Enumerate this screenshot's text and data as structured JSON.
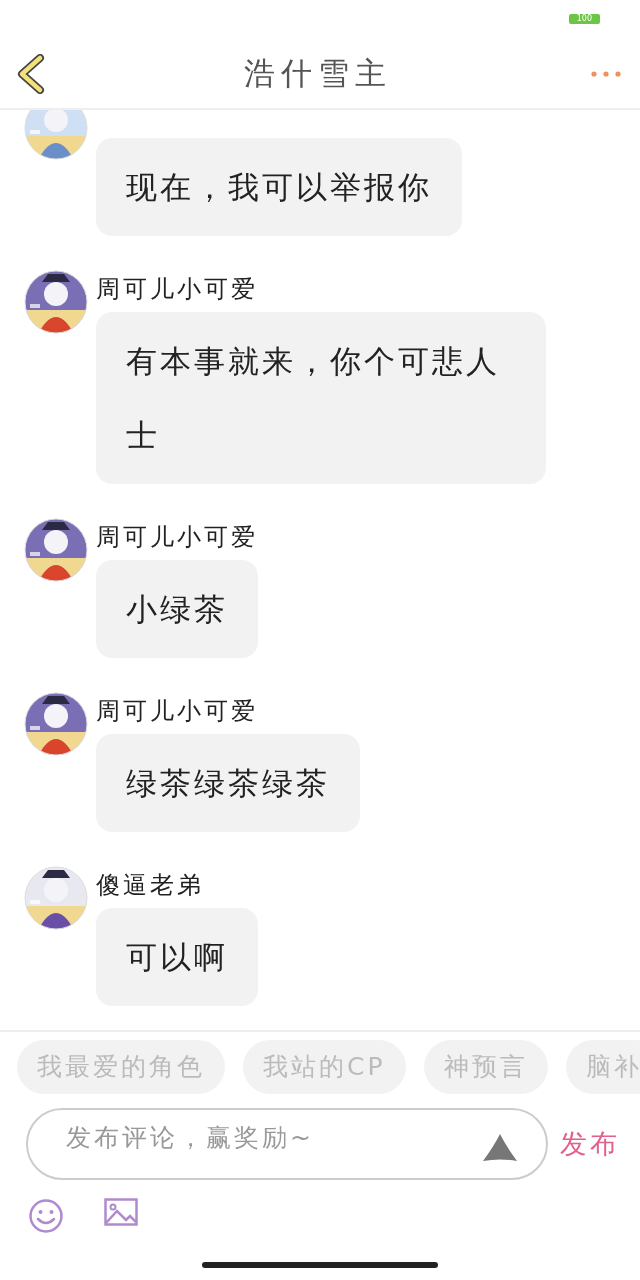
{
  "status_bar": {
    "battery": "100"
  },
  "header": {
    "title": "浩什雪主"
  },
  "messages": [
    {
      "text": "现在，我可以举报你"
    },
    {
      "name": "周可儿小可爱",
      "text": "有本事就来，你个可悲人士"
    },
    {
      "name": "周可儿小可爱",
      "text": "小绿茶"
    },
    {
      "name": "周可儿小可爱",
      "text": "绿茶绿茶绿茶"
    },
    {
      "name": "傻逼老弟",
      "text": "可以啊"
    }
  ],
  "topic_chips": [
    "我最爱的角色",
    "我站的CP",
    "神预言",
    "脑补"
  ],
  "composer": {
    "placeholder": "发布评论，赢奖励~",
    "send": "发布"
  }
}
